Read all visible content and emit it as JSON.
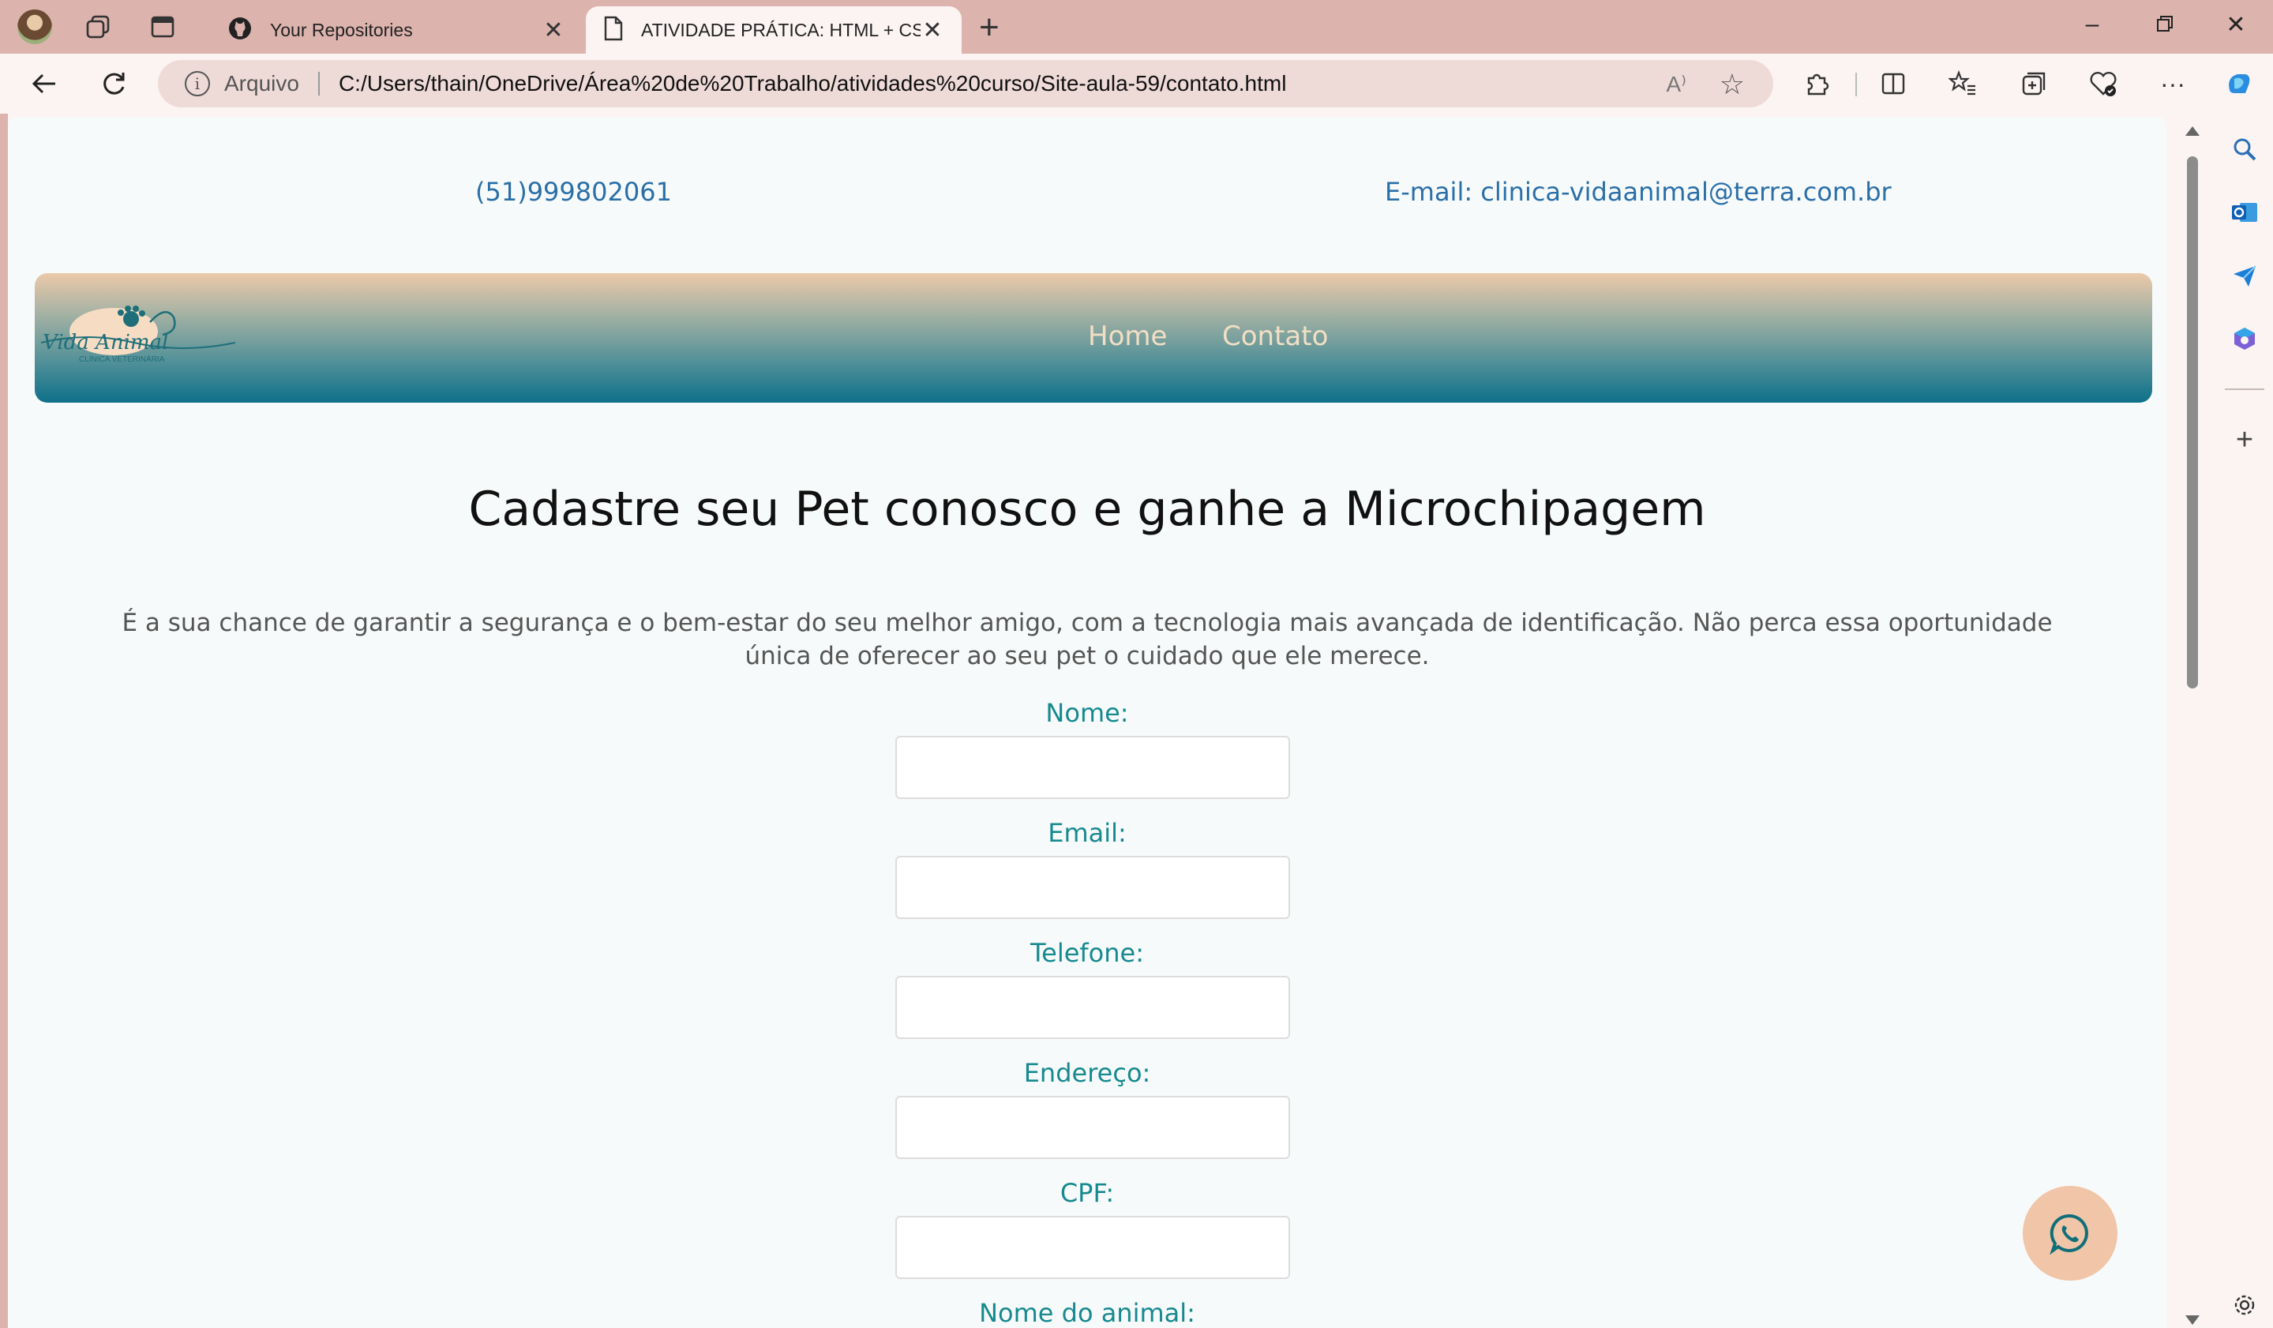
{
  "browser": {
    "tabs": [
      {
        "title": "Your Repositories",
        "icon": "github-icon",
        "active": false
      },
      {
        "title": "ATIVIDADE PRÁTICA: HTML + CSS",
        "icon": "document-icon",
        "active": true
      }
    ],
    "address": {
      "label": "Arquivo",
      "url": "C:/Users/thain/OneDrive/Área%20de%20Trabalho/atividades%20curso/Site-aula-59/contato.html",
      "read_aloud": "A⁾"
    }
  },
  "site": {
    "phone": "(51)999802061",
    "email": "E-mail: clinica-vidaanimal@terra.com.br",
    "logo": {
      "name": "Vida Animal",
      "subtitle": "CLÍNICA VETERINÁRIA"
    },
    "nav": [
      {
        "label": "Home"
      },
      {
        "label": "Contato"
      }
    ],
    "headline": "Cadastre seu Pet conosco e ganhe a Microchipagem",
    "intro": "É a sua chance de garantir a segurança e o bem-estar do seu melhor amigo, com a tecnologia mais avançada de identificação. Não perca essa oportunidade única de oferecer ao seu pet o cuidado que ele merece.",
    "form": {
      "fields": [
        {
          "label": "Nome:",
          "value": ""
        },
        {
          "label": "Email:",
          "value": ""
        },
        {
          "label": "Telefone:",
          "value": ""
        },
        {
          "label": "Endereço:",
          "value": ""
        },
        {
          "label": "CPF:",
          "value": ""
        }
      ],
      "partial_label": "Nome do animal:"
    },
    "whatsapp_icon": "whatsapp-icon"
  },
  "colors": {
    "tabstrip": "#dcb3ad",
    "toolbar": "#fbf4f3",
    "page_bg": "#f7fafa",
    "nav_gradient_top": "#ecc9a9",
    "nav_gradient_bottom": "#0e7089",
    "contact_text": "#2a6fa8",
    "form_label": "#168a8f",
    "whatsapp_button": "#f0c5a8"
  }
}
